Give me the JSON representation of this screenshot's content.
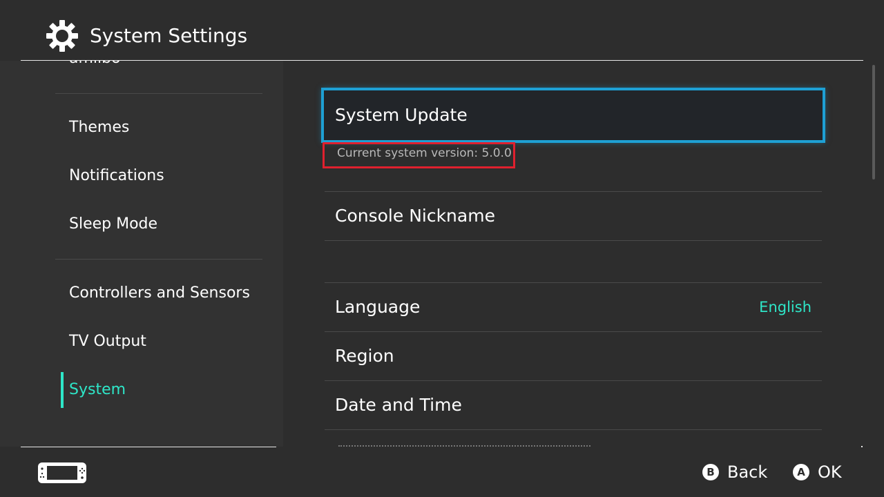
{
  "header": {
    "title": "System Settings",
    "icon": "gear-icon"
  },
  "sidebar": {
    "items": [
      {
        "label": "amiibo",
        "active": false
      },
      {
        "label": "Themes",
        "active": false
      },
      {
        "label": "Notifications",
        "active": false
      },
      {
        "label": "Sleep Mode",
        "active": false
      },
      {
        "label": "Controllers and Sensors",
        "active": false
      },
      {
        "label": "TV Output",
        "active": false
      },
      {
        "label": "System",
        "active": true
      }
    ]
  },
  "main": {
    "system_update": {
      "label": "System Update",
      "version_text": "Current system version: 5.0.0"
    },
    "console_nickname": {
      "label": "Console Nickname"
    },
    "language": {
      "label": "Language",
      "value": "English"
    },
    "region": {
      "label": "Region"
    },
    "date_time": {
      "label": "Date and Time"
    }
  },
  "footer": {
    "back": {
      "glyph": "B",
      "label": "Back"
    },
    "ok": {
      "glyph": "A",
      "label": "OK"
    },
    "console_icon": "console-handheld-icon"
  },
  "colors": {
    "background": "#2d2d2d",
    "sidebar": "#323232",
    "accent": "#2ee6c8",
    "selection_border": "#1ea0d4",
    "highlight_box": "#e0202e"
  }
}
